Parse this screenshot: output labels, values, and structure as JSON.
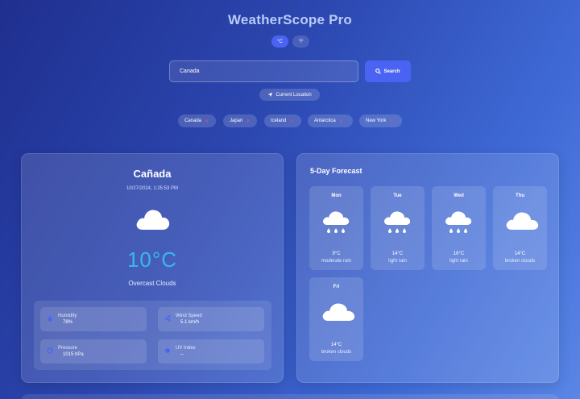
{
  "header": {
    "title": "WeatherScope Pro"
  },
  "units": {
    "celsius": "°C",
    "fahrenheit": "°F",
    "active": "celsius"
  },
  "search": {
    "value": "Canada",
    "button_label": "Search",
    "current_location_label": "Current Location"
  },
  "recent": [
    {
      "label": "Canada"
    },
    {
      "label": "Japan"
    },
    {
      "label": "Iceland"
    },
    {
      "label": "Antarctica"
    },
    {
      "label": "New York"
    }
  ],
  "current": {
    "city": "Cañada",
    "timestamp": "10/27/2024, 1:25:53 PM",
    "icon": "cloud-icon",
    "temperature": "10°C",
    "condition": "Overcast Clouds",
    "details": [
      {
        "label": "Humidity",
        "value": "78%",
        "icon": "droplet-icon"
      },
      {
        "label": "Wind Speed",
        "value": "5.1 km/h",
        "icon": "wind-icon"
      },
      {
        "label": "Pressure",
        "value": "1015 hPa",
        "icon": "gauge-icon"
      },
      {
        "label": "UV Index",
        "value": "--",
        "icon": "sun-icon"
      }
    ]
  },
  "forecast": {
    "title": "5-Day Forecast",
    "days": [
      {
        "day": "Mon",
        "temp": "9°C",
        "desc": "moderate rain",
        "icon": "rain-cloud-icon"
      },
      {
        "day": "Tue",
        "temp": "14°C",
        "desc": "light rain",
        "icon": "rain-cloud-icon"
      },
      {
        "day": "Wed",
        "temp": "16°C",
        "desc": "light rain",
        "icon": "rain-cloud-icon"
      },
      {
        "day": "Thu",
        "temp": "14°C",
        "desc": "broken clouds",
        "icon": "cloud-icon"
      },
      {
        "day": "Fri",
        "temp": "14°C",
        "desc": "broken clouds",
        "icon": "cloud-icon"
      }
    ]
  },
  "colors": {
    "accent": "#4a63f2",
    "temperature": "#36b8f2",
    "remove": "#e0507a"
  }
}
